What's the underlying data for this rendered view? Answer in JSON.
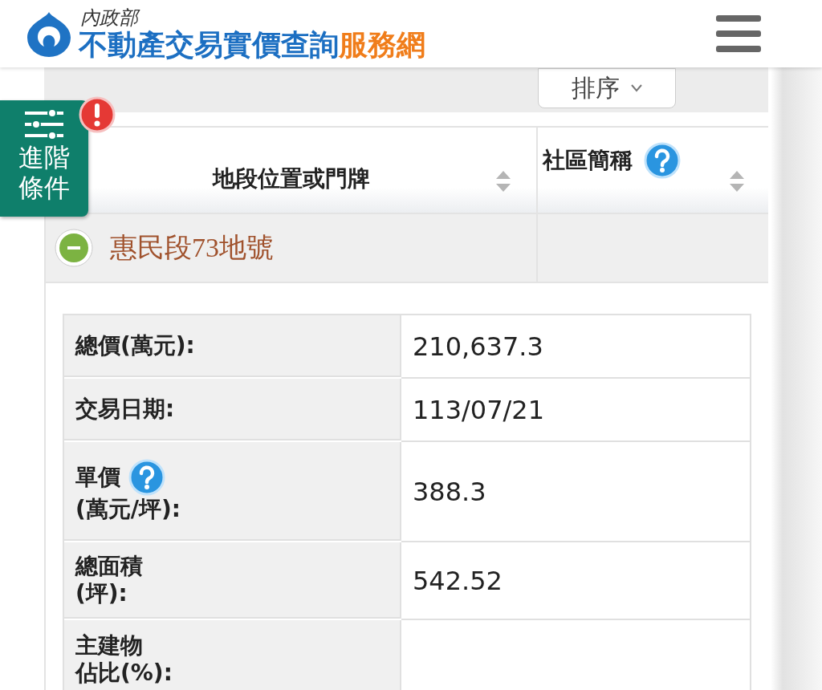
{
  "header": {
    "ministry": "內政部",
    "title": "不動產交易實價查詢",
    "title_suffix": "服務網"
  },
  "toolbar": [
    {
      "kind": "sort",
      "label": "排序"
    }
  ],
  "filter_button": {
    "lines": [
      "進階",
      "條件"
    ],
    "alert": true
  },
  "table": {
    "columns": [
      {
        "label": "地段位置或門牌",
        "help": false
      },
      {
        "label": "社區簡稱",
        "help": true
      }
    ],
    "rows": [
      {
        "address": "惠民段73地號",
        "expanded": true
      }
    ]
  },
  "details": [
    {
      "lines": [
        "總價(萬元):"
      ],
      "value": "210,637.3"
    },
    {
      "lines": [
        "交易日期:"
      ],
      "value": "113/07/21"
    },
    {
      "lines": [
        "單價",
        "(萬元/坪):"
      ],
      "help": true,
      "value": "388.3"
    },
    {
      "lines": [
        "總面積",
        "(坪):"
      ],
      "value": "542.52"
    },
    {
      "lines": [
        "主建物",
        "佔比(%):"
      ]
    }
  ]
}
